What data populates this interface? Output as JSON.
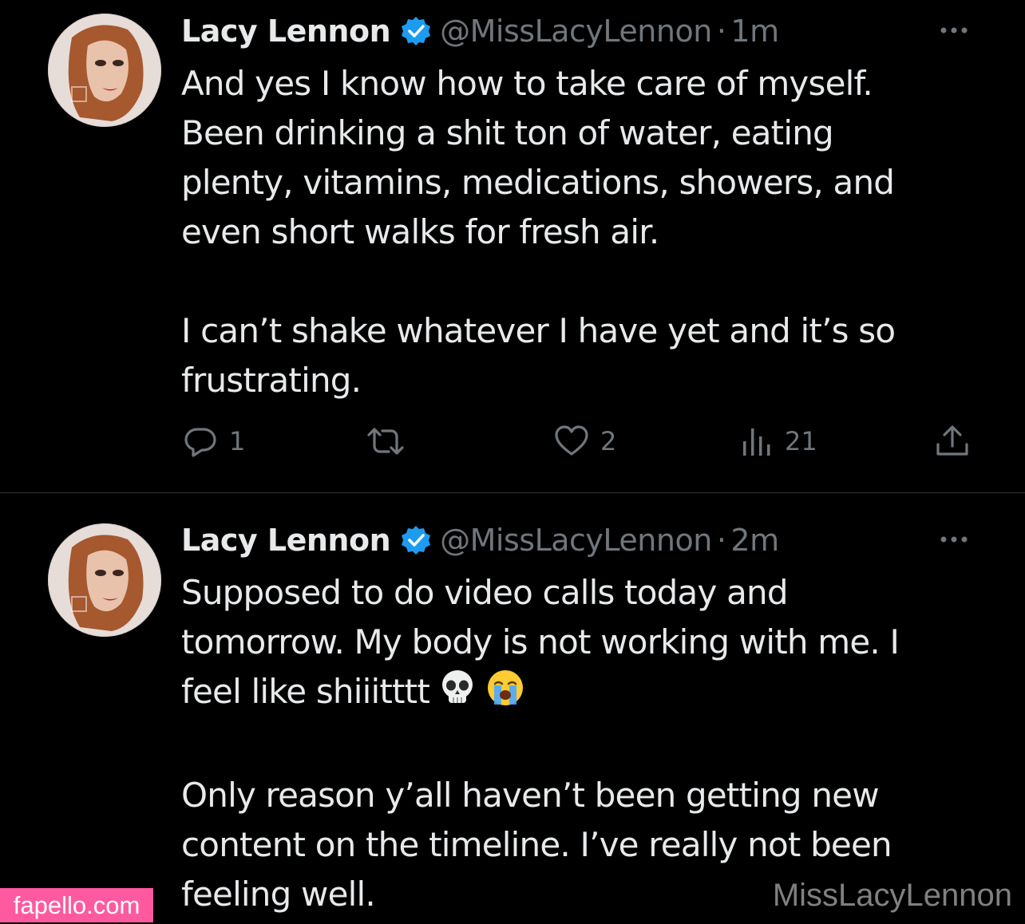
{
  "colors": {
    "background": "#000000",
    "text": "#e7e9ea",
    "muted": "#71767b",
    "divider": "#2f3336",
    "verified": "#1d9bf0",
    "brand": "#ff5aa0"
  },
  "tweets": [
    {
      "display_name": "Lacy Lennon",
      "handle": "@MissLacyLennon",
      "separator": "·",
      "time": "1m",
      "paragraphs": [
        "And yes I know how to take care of myself.\nBeen drinking a shit ton of water, eating\nplenty, vitamins, medications, showers, and\neven short walks for fresh air.",
        "I can’t shake whatever I have yet and it’s so\nfrustrating."
      ],
      "actions": {
        "replies": "1",
        "reposts": "",
        "likes": "2",
        "views": "21"
      },
      "icons": [
        "verified-badge-icon",
        "more-icon",
        "reply-icon",
        "retweet-icon",
        "heart-icon",
        "views-icon",
        "share-icon"
      ]
    },
    {
      "display_name": "Lacy Lennon",
      "handle": "@MissLacyLennon",
      "separator": "·",
      "time": "2m",
      "paragraphs": [
        "Supposed to do video calls today and\ntomorrow. My body is not working with me. I\nfeel like shiiitttt",
        "Only reason y’all haven’t been getting new\ncontent on the timeline. I’ve really not been\nfeeling well."
      ],
      "emoji": [
        "skull-emoji",
        "loudly-crying-face-emoji"
      ],
      "icons": [
        "verified-badge-icon",
        "more-icon"
      ]
    }
  ],
  "watermarks": {
    "brand": "fapello.com",
    "user": "MissLacyLennon"
  }
}
